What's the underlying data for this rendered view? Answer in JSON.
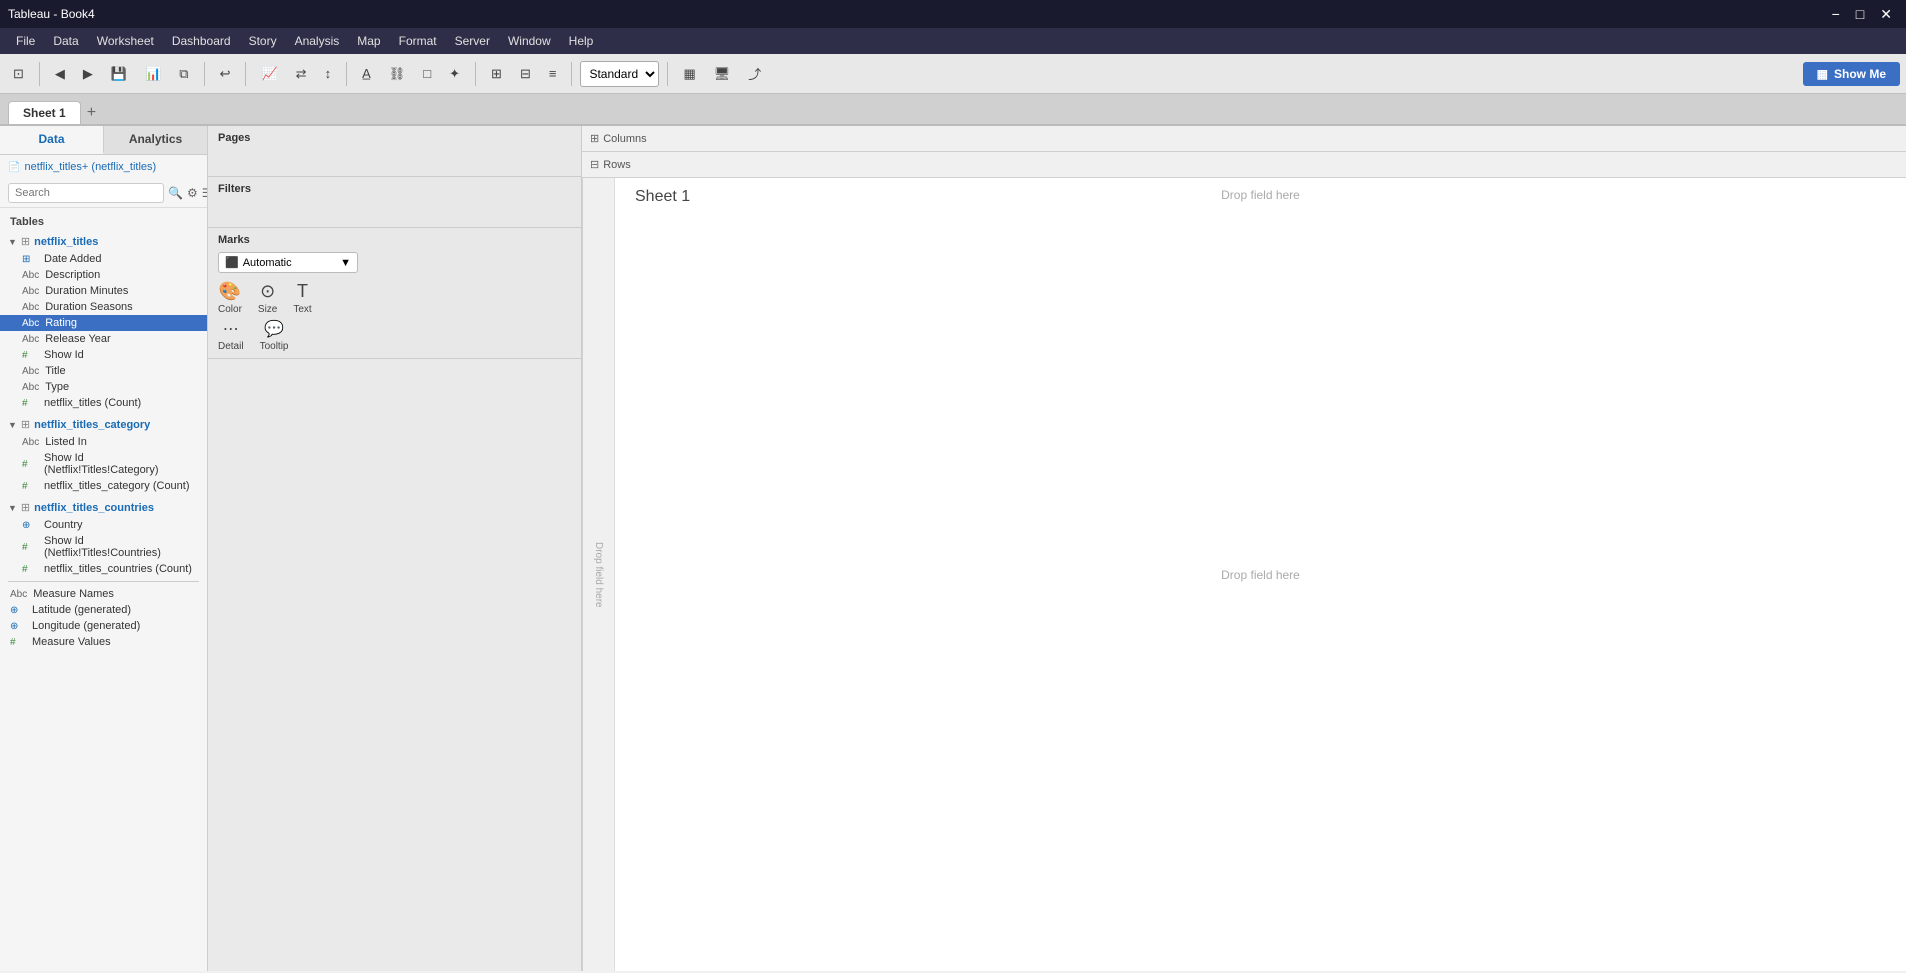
{
  "window": {
    "title": "Tableau - Book4",
    "minimize": "−",
    "maximize": "□",
    "close": "✕"
  },
  "menu": {
    "items": [
      "File",
      "Data",
      "Worksheet",
      "Dashboard",
      "Story",
      "Analysis",
      "Map",
      "Format",
      "Server",
      "Window",
      "Help"
    ]
  },
  "toolbar": {
    "standard_label": "Standard",
    "show_me_label": "Show Me",
    "show_me_icon": "≡"
  },
  "tabs": {
    "sheet1": "Sheet 1",
    "active": "Sheet 1"
  },
  "left_panel": {
    "data_tab": "Data",
    "analytics_tab": "Analytics",
    "connection": "netflix_titles+ (netflix_titles)",
    "search_placeholder": "Search"
  },
  "tables": {
    "section_label": "Tables",
    "netflix_titles": {
      "name": "netflix_titles",
      "fields": [
        {
          "name": "Date Added",
          "type": "date",
          "icon": "⊞",
          "color": "blue"
        },
        {
          "name": "Description",
          "type": "string",
          "icon": "Abc",
          "color": "gray"
        },
        {
          "name": "Duration Minutes",
          "type": "string",
          "icon": "Abc",
          "color": "gray"
        },
        {
          "name": "Duration Seasons",
          "type": "string",
          "icon": "Abc",
          "color": "gray"
        },
        {
          "name": "Rating",
          "type": "string",
          "icon": "Abc",
          "color": "gray",
          "selected": true
        },
        {
          "name": "Release Year",
          "type": "string",
          "icon": "Abc",
          "color": "gray"
        },
        {
          "name": "Show Id",
          "type": "number",
          "icon": "#",
          "color": "green"
        },
        {
          "name": "Title",
          "type": "string",
          "icon": "Abc",
          "color": "gray"
        },
        {
          "name": "Type",
          "type": "string",
          "icon": "Abc",
          "color": "gray"
        },
        {
          "name": "netflix_titles (Count)",
          "type": "count",
          "icon": "#",
          "color": "green"
        }
      ]
    },
    "netflix_titles_category": {
      "name": "netflix_titles_category",
      "fields": [
        {
          "name": "Listed In",
          "type": "string",
          "icon": "Abc",
          "color": "gray"
        },
        {
          "name": "Show Id (Netflix!Titles!Category)",
          "type": "number",
          "icon": "#",
          "color": "green"
        },
        {
          "name": "netflix_titles_category (Count)",
          "type": "count",
          "icon": "#",
          "color": "green"
        }
      ]
    },
    "netflix_titles_countries": {
      "name": "netflix_titles_countries",
      "fields": [
        {
          "name": "Country",
          "type": "geo",
          "icon": "⊕",
          "color": "blue"
        },
        {
          "name": "Show Id (Netflix!Titles!Countries)",
          "type": "number",
          "icon": "#",
          "color": "green"
        },
        {
          "name": "netflix_titles_countries (Count)",
          "type": "count",
          "icon": "#",
          "color": "green"
        }
      ]
    }
  },
  "measures": {
    "fields": [
      {
        "name": "Measure Names",
        "type": "string",
        "icon": "Abc",
        "color": "gray"
      },
      {
        "name": "Latitude (generated)",
        "type": "geo",
        "icon": "⊕",
        "color": "blue"
      },
      {
        "name": "Longitude (generated)",
        "type": "geo",
        "icon": "⊕",
        "color": "blue"
      },
      {
        "name": "Measure Values",
        "type": "number",
        "icon": "#",
        "color": "green"
      }
    ]
  },
  "pages_card": {
    "title": "Pages"
  },
  "filters_card": {
    "title": "Filters"
  },
  "marks_card": {
    "title": "Marks",
    "type": "Automatic",
    "color_label": "Color",
    "size_label": "Size",
    "text_label": "Text",
    "detail_label": "Detail",
    "tooltip_label": "Tooltip"
  },
  "canvas": {
    "columns_label": "Columns",
    "rows_label": "Rows",
    "sheet_title": "Sheet 1",
    "drop_field_top": "Drop field here",
    "drop_field_center": "Drop field here",
    "drop_field_left": "Drop field here"
  }
}
